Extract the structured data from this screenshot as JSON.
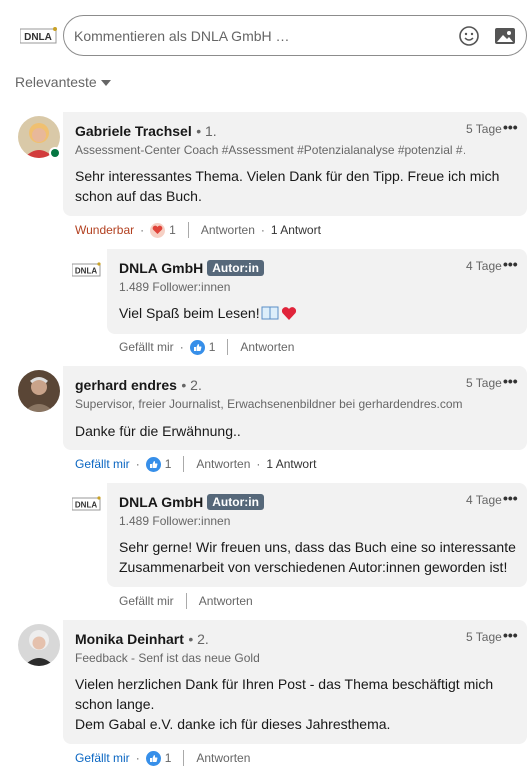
{
  "composer": {
    "logo_text": "DNLA",
    "placeholder": "Kommentieren als DNLA GmbH …"
  },
  "sort": {
    "label": "Relevanteste"
  },
  "colors": {
    "bubble": "#f2f2f2",
    "link_blue": "#0a66c2",
    "celebrate": "#b24020",
    "badge": "#56687a",
    "heart": "#e0443a"
  },
  "comments": [
    {
      "name": "Gabriele Trachsel",
      "degree": "• 1.",
      "headline": "Assessment-Center Coach #Assessment #Potenzialanalyse #potenzial #…",
      "time": "5 Tage",
      "text_lines": [
        "Sehr interessantes Thema. Vielen Dank für den Tipp. Freue ich mich",
        "schon auf das Buch."
      ],
      "reaction_label": "Wunderbar",
      "reaction_count": "1",
      "reply_label": "Antworten",
      "replies_count": "1 Antwort",
      "reply": {
        "name": "DNLA GmbH",
        "badge": "Autor:in",
        "followers": "1.489 Follower:innen",
        "time": "4 Tage",
        "text_lines": [
          "Viel Spaß beim Lesen!"
        ],
        "like_label": "Gefällt mir",
        "like_count": "1",
        "reply_label": "Antworten"
      }
    },
    {
      "name": "gerhard endres",
      "degree": "• 2.",
      "headline": "Supervisor, freier Journalist, Erwachsenenbildner bei gerhardendres.com",
      "time": "5 Tage",
      "text_lines": [
        "Danke für die Erwähnung.."
      ],
      "reaction_label": "Gefällt mir",
      "reaction_count": "1",
      "reply_label": "Antworten",
      "replies_count": "1 Antwort",
      "reply": {
        "name": "DNLA GmbH",
        "badge": "Autor:in",
        "followers": "1.489 Follower:innen",
        "time": "4 Tage",
        "text_lines": [
          "Sehr gerne! Wir freuen uns, dass das Buch eine so interessante",
          "Zusammenarbeit von verschiedenen Autor:innen geworden ist!"
        ],
        "like_label": "Gefällt mir",
        "reply_label": "Antworten"
      }
    },
    {
      "name": "Monika Deinhart",
      "degree": "• 2.",
      "headline": "Feedback - Senf ist das neue Gold",
      "time": "5 Tage",
      "text_lines": [
        "Vielen herzlichen Dank für Ihren Post - das Thema beschäftigt mich",
        "schon lange.",
        "Dem Gabal e.V. danke ich für dieses Jahresthema."
      ],
      "reaction_label": "Gefällt mir",
      "reaction_count": "1",
      "reply_label": "Antworten"
    }
  ]
}
